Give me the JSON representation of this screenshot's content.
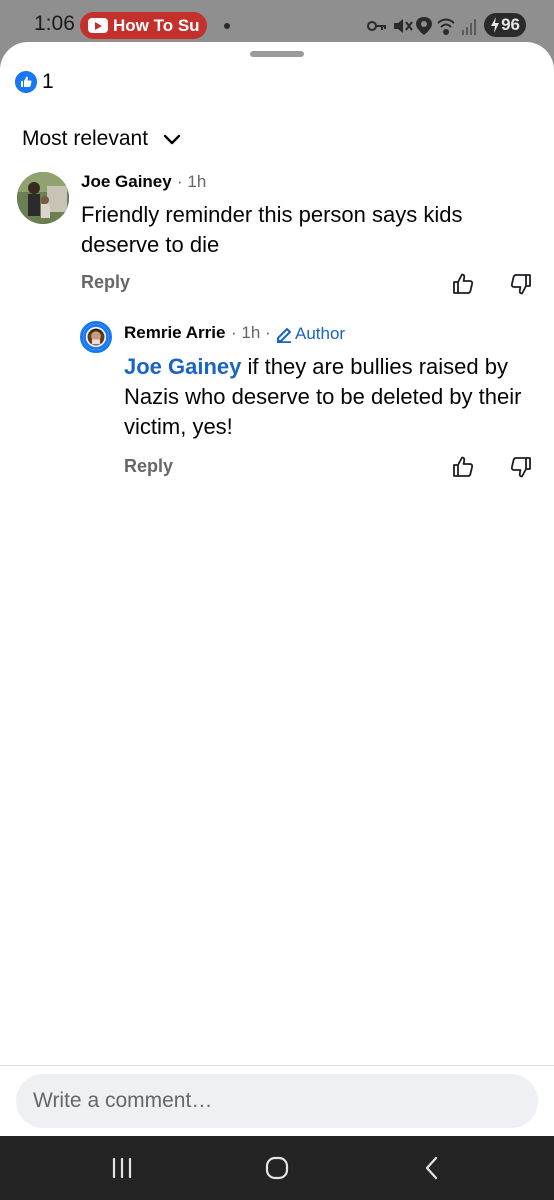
{
  "status_bar": {
    "time": "1:06",
    "notification_label": "How To Su",
    "battery": "96",
    "icons": [
      "key-icon",
      "mute-icon",
      "location-icon",
      "wifi-icon",
      "signal-icon"
    ]
  },
  "sheet": {
    "reaction_count": "1",
    "sort_label": "Most relevant"
  },
  "comments": [
    {
      "author": "Joe Gainey",
      "time": "· 1h",
      "text": "Friendly reminder this person says kids deserve to die",
      "reply_label": "Reply"
    }
  ],
  "reply": {
    "author": "Remrie Arrie",
    "time": "· 1h ·",
    "badge": "Author",
    "mention": "Joe Gainey",
    "text": " if they are bullies raised by Nazis who deserve to be deleted by their victim, yes!",
    "reply_label": "Reply"
  },
  "composer": {
    "placeholder": "Write a comment…"
  },
  "colors": {
    "accent": "#1877f2",
    "link": "#1a64c5",
    "notification": "#c4302b"
  }
}
